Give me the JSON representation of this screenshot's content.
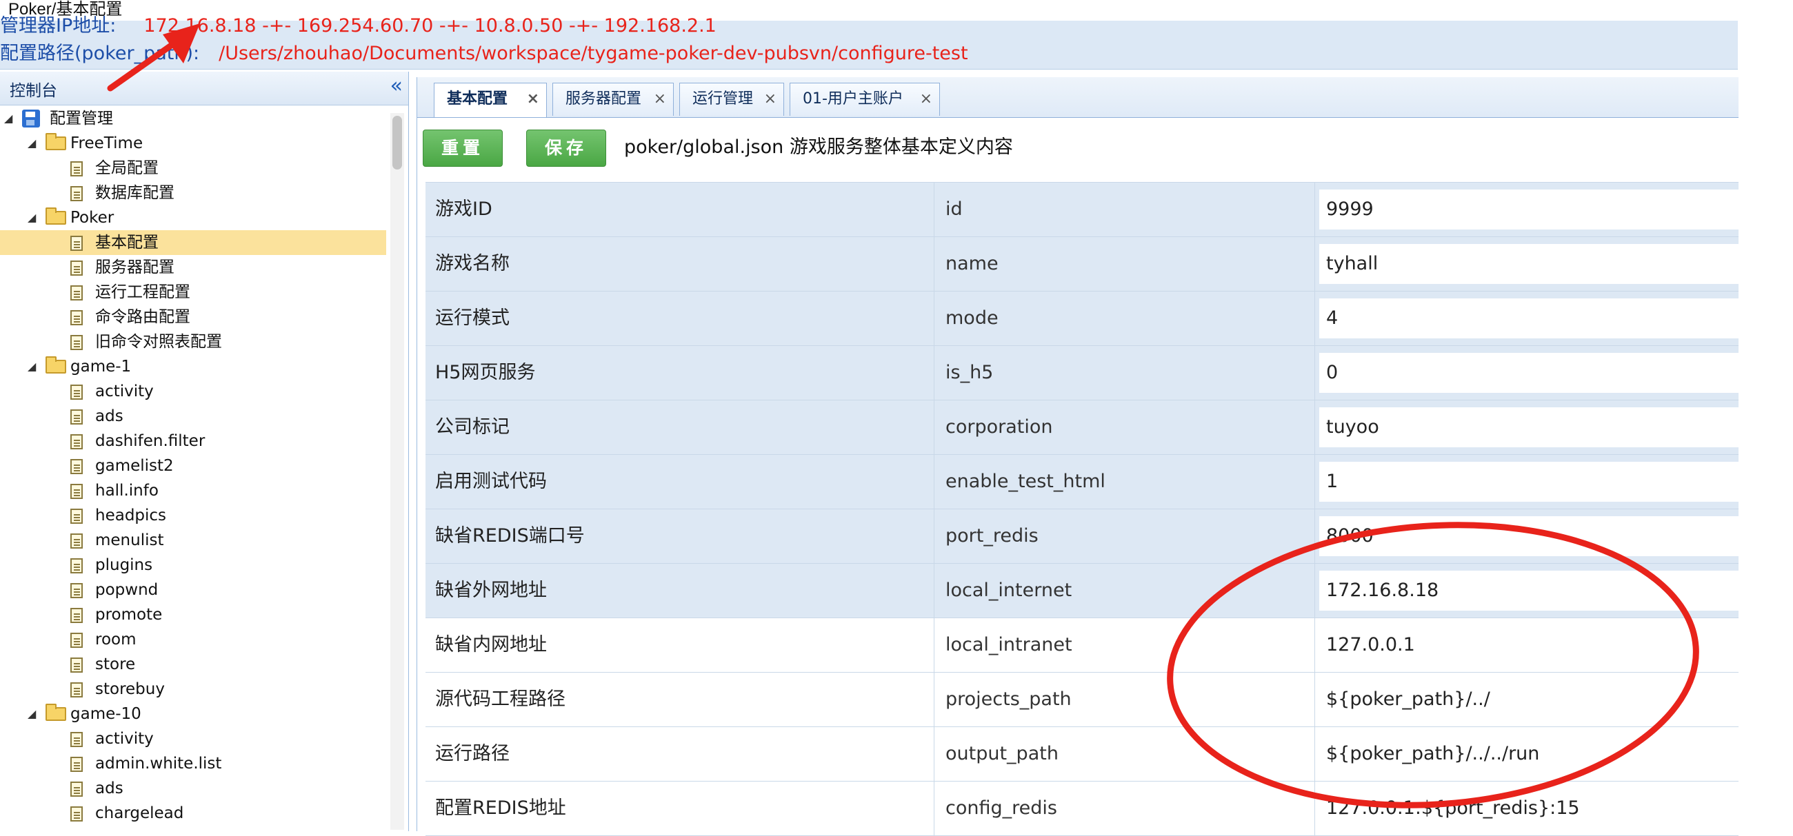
{
  "page_title": "Poker/基本配置",
  "info": {
    "ip_label": "管理器IP地址:",
    "ip_value": "172.16.8.18 -+- 169.254.60.70 -+- 10.8.0.50 -+- 192.168.2.1",
    "path_label": "配置路径(poker_path):",
    "path_value": "/Users/zhouhao/Documents/workspace/tygame-poker-dev-pubsvn/configure-test"
  },
  "left_panel": {
    "title": "控制台",
    "collapse_glyph": "«"
  },
  "tree": [
    {
      "label": "配置管理",
      "level": 0,
      "type": "disk",
      "toggle": "◢"
    },
    {
      "label": "FreeTime",
      "level": 1,
      "type": "folder",
      "toggle": "◢"
    },
    {
      "label": "全局配置",
      "level": 2,
      "type": "file"
    },
    {
      "label": "数据库配置",
      "level": 2,
      "type": "file"
    },
    {
      "label": "Poker",
      "level": 1,
      "type": "folder",
      "toggle": "◢"
    },
    {
      "label": "基本配置",
      "level": 2,
      "type": "file",
      "selected": true
    },
    {
      "label": "服务器配置",
      "level": 2,
      "type": "file"
    },
    {
      "label": "运行工程配置",
      "level": 2,
      "type": "file"
    },
    {
      "label": "命令路由配置",
      "level": 2,
      "type": "file"
    },
    {
      "label": "旧命令对照表配置",
      "level": 2,
      "type": "file"
    },
    {
      "label": "game-1",
      "level": 1,
      "type": "folder",
      "toggle": "◢"
    },
    {
      "label": "activity",
      "level": 2,
      "type": "file"
    },
    {
      "label": "ads",
      "level": 2,
      "type": "file"
    },
    {
      "label": "dashifen.filter",
      "level": 2,
      "type": "file"
    },
    {
      "label": "gamelist2",
      "level": 2,
      "type": "file"
    },
    {
      "label": "hall.info",
      "level": 2,
      "type": "file"
    },
    {
      "label": "headpics",
      "level": 2,
      "type": "file"
    },
    {
      "label": "menulist",
      "level": 2,
      "type": "file"
    },
    {
      "label": "plugins",
      "level": 2,
      "type": "file"
    },
    {
      "label": "popwnd",
      "level": 2,
      "type": "file"
    },
    {
      "label": "promote",
      "level": 2,
      "type": "file"
    },
    {
      "label": "room",
      "level": 2,
      "type": "file"
    },
    {
      "label": "store",
      "level": 2,
      "type": "file"
    },
    {
      "label": "storebuy",
      "level": 2,
      "type": "file"
    },
    {
      "label": "game-10",
      "level": 1,
      "type": "folder",
      "toggle": "◢"
    },
    {
      "label": "activity",
      "level": 2,
      "type": "file"
    },
    {
      "label": "admin.white.list",
      "level": 2,
      "type": "file"
    },
    {
      "label": "ads",
      "level": 2,
      "type": "file"
    },
    {
      "label": "chargelead",
      "level": 2,
      "type": "file"
    }
  ],
  "tabs": [
    {
      "label": "基本配置",
      "close": "×",
      "active": true
    },
    {
      "label": "服务器配置",
      "close": "×",
      "active": false
    },
    {
      "label": "运行管理",
      "close": "×",
      "active": false
    },
    {
      "label": "01-用户主账户",
      "close": "×",
      "active": false
    }
  ],
  "toolbar": {
    "reset_label": "重置",
    "save_label": "保存",
    "description": "poker/global.json 游戏服务整体基本定义内容"
  },
  "grid": [
    {
      "desc": "游戏ID",
      "key": "id",
      "value": "9999",
      "shaded": true
    },
    {
      "desc": "游戏名称",
      "key": "name",
      "value": "tyhall",
      "shaded": true
    },
    {
      "desc": "运行模式",
      "key": "mode",
      "value": "4",
      "shaded": true
    },
    {
      "desc": "H5网页服务",
      "key": "is_h5",
      "value": "0",
      "shaded": true
    },
    {
      "desc": "公司标记",
      "key": "corporation",
      "value": "tuyoo",
      "shaded": true
    },
    {
      "desc": "启用测试代码",
      "key": "enable_test_html",
      "value": "1",
      "shaded": true
    },
    {
      "desc": "缺省REDIS端口号",
      "key": "port_redis",
      "value": "8000",
      "shaded": true
    },
    {
      "desc": "缺省外网地址",
      "key": "local_internet",
      "value": "172.16.8.18",
      "shaded": true
    },
    {
      "desc": "缺省内网地址",
      "key": "local_intranet",
      "value": "127.0.0.1",
      "shaded": false
    },
    {
      "desc": "源代码工程路径",
      "key": "projects_path",
      "value": "${poker_path}/../",
      "shaded": false
    },
    {
      "desc": "运行路径",
      "key": "output_path",
      "value": "${poker_path}/../../run",
      "shaded": false
    },
    {
      "desc": "配置REDIS地址",
      "key": "config_redis",
      "value": "127.0.0.1:${port_redis}:15",
      "shaded": false
    }
  ],
  "colors": {
    "annotation": "#e8231b",
    "info_label": "#1d4ea8",
    "info_value": "#e8231b",
    "selected_row": "#fbe29c",
    "button": "#4aa744"
  },
  "icons": {
    "root": "disk-icon",
    "folder": "folder-icon",
    "file": "file-icon",
    "collapse": "double-chevron-left-icon",
    "tab_close": "close-icon"
  }
}
